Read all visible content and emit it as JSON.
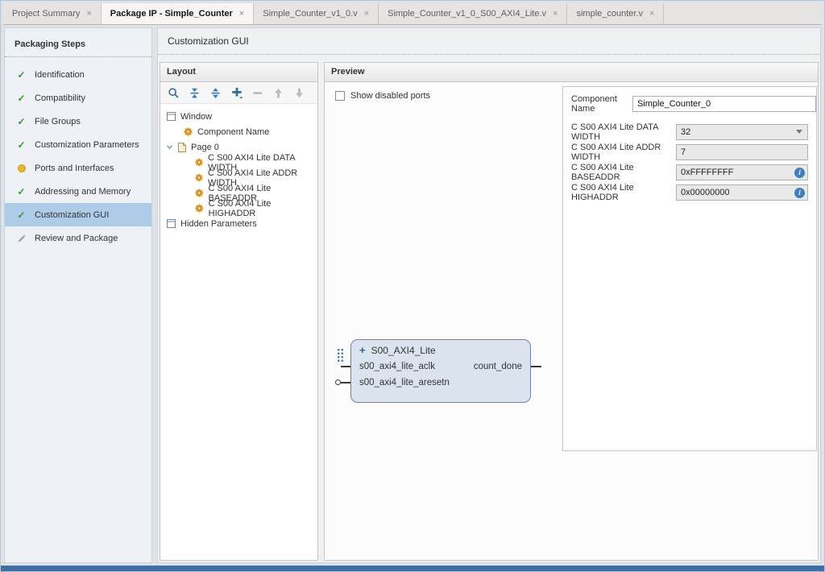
{
  "icons": {
    "close": "×",
    "check": "✓",
    "plus": "+",
    "info": "i"
  },
  "tabs": [
    {
      "label": "Project Summary"
    },
    {
      "label": "Package IP - Simple_Counter"
    },
    {
      "label": "Simple_Counter_v1_0.v"
    },
    {
      "label": "Simple_Counter_v1_0_S00_AXI4_Lite.v"
    },
    {
      "label": "simple_counter.v"
    }
  ],
  "sidebar": {
    "title": "Packaging Steps",
    "items": [
      {
        "label": "Identification",
        "status": "complete"
      },
      {
        "label": "Compatibility",
        "status": "complete"
      },
      {
        "label": "File Groups",
        "status": "complete"
      },
      {
        "label": "Customization Parameters",
        "status": "complete"
      },
      {
        "label": "Ports and Interfaces",
        "status": "attention"
      },
      {
        "label": "Addressing and Memory",
        "status": "complete"
      },
      {
        "label": "Customization GUI",
        "status": "complete",
        "selected": true
      },
      {
        "label": "Review and Package",
        "status": "pending"
      }
    ]
  },
  "main": {
    "title": "Customization GUI",
    "layout": {
      "title": "Layout",
      "tree": [
        {
          "label": "Window"
        },
        {
          "label": "Component Name"
        },
        {
          "label": "Page 0"
        },
        {
          "label": "C S00 AXI4 Lite DATA WIDTH"
        },
        {
          "label": "C S00 AXI4 Lite ADDR WIDTH"
        },
        {
          "label": "C S00 AXI4 Lite BASEADDR"
        },
        {
          "label": "C S00 AXI4 Lite HIGHADDR"
        },
        {
          "label": "Hidden Parameters"
        }
      ]
    },
    "preview": {
      "title": "Preview",
      "show_disabled_ports_label": "Show disabled ports",
      "block": {
        "title": "S00_AXI4_Lite",
        "ports_left": [
          "s00_axi4_lite_aclk",
          "s00_axi4_lite_aresetn"
        ],
        "ports_right": [
          "count_done"
        ]
      },
      "properties": {
        "component_name_label": "Component Name",
        "component_name_value": "Simple_Counter_0",
        "fields": [
          {
            "label": "C S00 AXI4 Lite DATA WIDTH",
            "value": "32"
          },
          {
            "label": "C S00 AXI4 Lite ADDR WIDTH",
            "value": "7"
          },
          {
            "label": "C S00 AXI4 Lite BASEADDR",
            "value": "0xFFFFFFFF"
          },
          {
            "label": "C S00 AXI4 Lite HIGHADDR",
            "value": "0x00000000"
          }
        ]
      }
    }
  }
}
